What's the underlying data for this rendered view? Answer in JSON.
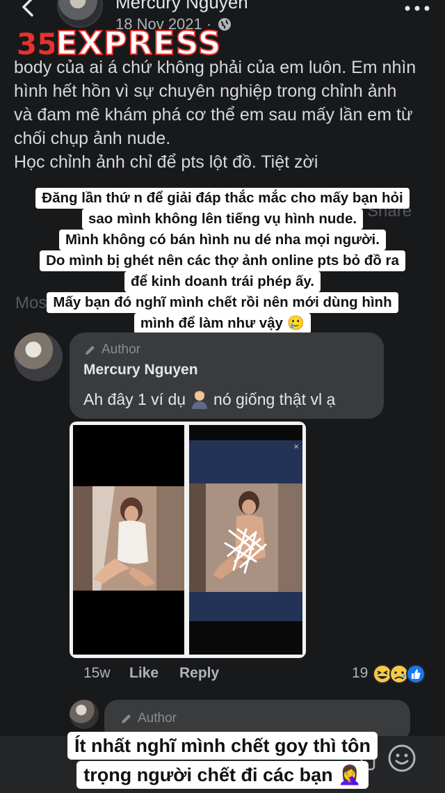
{
  "header": {
    "author_name": "Mercury Nguyen",
    "date": "18 Nov 2021 ·",
    "watermark": "EXPRESS"
  },
  "post": {
    "lines": [
      "body của ai á chứ không phải của em luôn. Em nhìn",
      "hình hết hồn vì sự chuyên nghiệp trong chỉnh ảnh",
      "và đam mê khám phá cơ thể em sau mấy lần em từ",
      "chối chụp ảnh nude.",
      "Học chỉnh ảnh chỉ để pts lột đồ. Tiệt zời"
    ],
    "share_label": "Share",
    "sort_label": "Most releva"
  },
  "overlay": {
    "lines": [
      "Đăng lần thứ n để giải đáp thắc mắc cho mấy bạn hỏi",
      "sao mình không lên tiếng vụ hình nude.",
      "Mình không có bán hình nu dé nha mọi người.",
      "Do mình bị ghét nên các thợ ảnh online pts bỏ đồ ra",
      "để kinh doanh trái phép ấy.",
      "Mấy bạn đó nghĩ mình chết rồi nên mới dùng hình",
      "mình để làm như vậy 🥲"
    ]
  },
  "comment": {
    "author_badge": "Author",
    "name": "Mercury Nguyen",
    "text_before": "Ah đây 1 ví dụ",
    "text_after": "nó giống thật vl ạ",
    "time": "15w",
    "like_label": "Like",
    "reply_label": "Reply",
    "reaction_count": "19"
  },
  "reply": {
    "author_badge": "Author"
  },
  "caption": {
    "lines": [
      "Ít nhất nghĩ mình chết goy thì tôn",
      "trọng người chết đi các bạn 🤦‍♀️"
    ]
  },
  "colors": {
    "background": "#18191a",
    "bubble": "#3a3b3c",
    "overlay_bg": "#ffffff",
    "watermark_stroke": "#e8322e"
  }
}
